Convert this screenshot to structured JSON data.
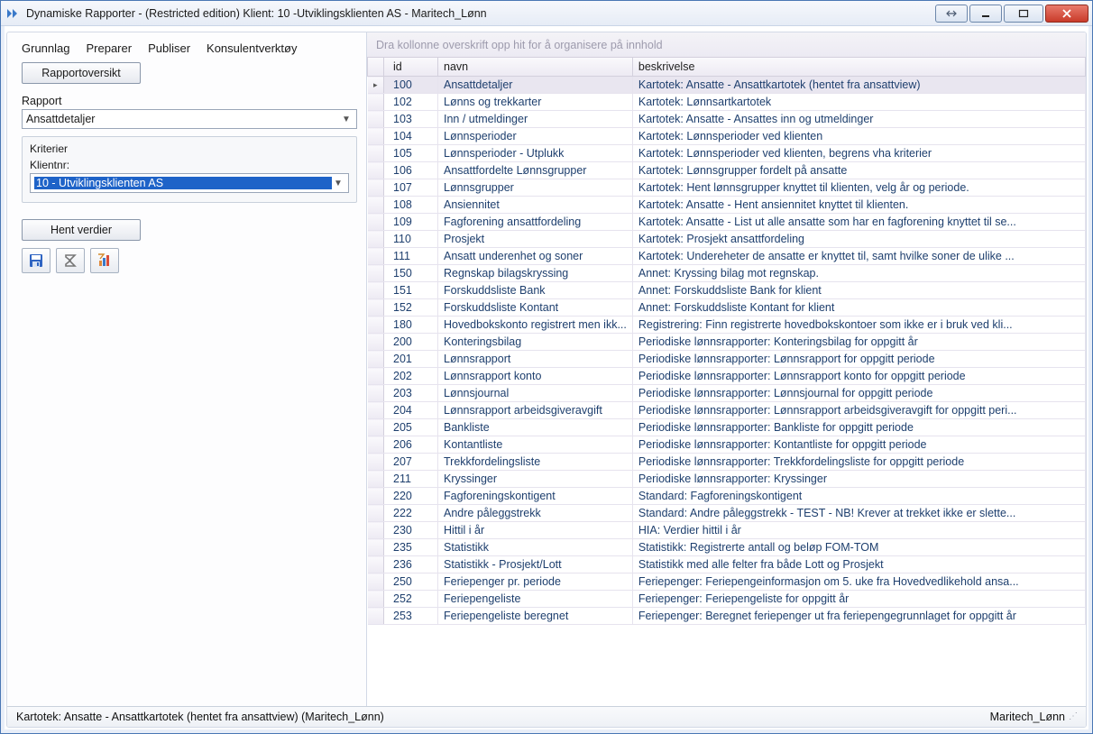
{
  "window": {
    "title": "Dynamiske Rapporter - (Restricted edition)  Klient: 10 -Utviklingsklienten AS - Maritech_Lønn"
  },
  "menubar": {
    "m1": "Grunnlag",
    "m2": "Preparer",
    "m3": "Publiser",
    "m4": "Konsulentverktøy"
  },
  "buttons": {
    "rapportoversikt": "Rapportoversikt",
    "hent_verdier": "Hent verdier"
  },
  "labels": {
    "rapport": "Rapport",
    "kriterier": "Kriterier",
    "klientnr": "Klientnr:"
  },
  "combos": {
    "rapport_value": "Ansattdetaljer",
    "klient_value": "10 - Utviklingsklienten AS"
  },
  "group_strip": "Dra kollonne overskrift opp hit for å organisere på innhold",
  "grid": {
    "headers": {
      "id": "id",
      "navn": "navn",
      "beskrivelse": "beskrivelse"
    },
    "rows": [
      {
        "id": "100",
        "navn": "Ansattdetaljer",
        "beskr": "Kartotek: Ansatte - Ansattkartotek (hentet fra ansattview)",
        "selected": true
      },
      {
        "id": "102",
        "navn": "Lønns og trekkarter",
        "beskr": "Kartotek: Lønnsartkartotek"
      },
      {
        "id": "103",
        "navn": "Inn / utmeldinger",
        "beskr": "Kartotek: Ansatte - Ansattes inn og utmeldinger"
      },
      {
        "id": "104",
        "navn": "Lønnsperioder",
        "beskr": "Kartotek: Lønnsperioder ved klienten"
      },
      {
        "id": "105",
        "navn": "Lønnsperioder - Utplukk",
        "beskr": "Kartotek: Lønnsperioder ved klienten, begrens vha kriterier"
      },
      {
        "id": "106",
        "navn": "Ansattfordelte Lønnsgrupper",
        "beskr": "Kartotek: Lønnsgrupper fordelt på ansatte"
      },
      {
        "id": "107",
        "navn": "Lønnsgrupper",
        "beskr": "Kartotek: Hent lønnsgrupper knyttet til klienten, velg år og periode."
      },
      {
        "id": "108",
        "navn": "Ansiennitet",
        "beskr": "Kartotek: Ansatte - Hent ansiennitet knyttet til klienten."
      },
      {
        "id": "109",
        "navn": "Fagforening ansattfordeling",
        "beskr": "Kartotek: Ansatte - List ut alle ansatte som har en fagforening knyttet til se..."
      },
      {
        "id": "110",
        "navn": "Prosjekt",
        "beskr": "Kartotek: Prosjekt ansattfordeling"
      },
      {
        "id": "111",
        "navn": "Ansatt underenhet og soner",
        "beskr": "Kartotek: Undereheter de ansatte er knyttet til, samt hvilke soner de ulike ..."
      },
      {
        "id": "150",
        "navn": "Regnskap bilagskryssing",
        "beskr": "Annet: Kryssing bilag mot regnskap."
      },
      {
        "id": "151",
        "navn": "Forskuddsliste Bank",
        "beskr": "Annet: Forskuddsliste Bank for klient"
      },
      {
        "id": "152",
        "navn": "Forskuddsliste Kontant",
        "beskr": "Annet: Forskuddsliste Kontant for klient"
      },
      {
        "id": "180",
        "navn": "Hovedbokskonto registrert men ikk...",
        "beskr": "Registrering: Finn registrerte hovedbokskontoer som ikke er i bruk ved kli..."
      },
      {
        "id": "200",
        "navn": "Konteringsbilag",
        "beskr": "Periodiske lønnsrapporter: Konteringsbilag for oppgitt år"
      },
      {
        "id": "201",
        "navn": "Lønnsrapport",
        "beskr": "Periodiske lønnsrapporter: Lønnsrapport for oppgitt periode"
      },
      {
        "id": "202",
        "navn": "Lønnsrapport konto",
        "beskr": "Periodiske lønnsrapporter: Lønnsrapport konto for oppgitt periode"
      },
      {
        "id": "203",
        "navn": "Lønnsjournal",
        "beskr": "Periodiske lønnsrapporter: Lønnsjournal for oppgitt periode"
      },
      {
        "id": "204",
        "navn": "Lønnsrapport arbeidsgiveravgift",
        "beskr": "Periodiske lønnsrapporter: Lønnsrapport arbeidsgiveravgift for oppgitt peri..."
      },
      {
        "id": "205",
        "navn": "Bankliste",
        "beskr": "Periodiske lønnsrapporter: Bankliste  for oppgitt periode"
      },
      {
        "id": "206",
        "navn": "Kontantliste",
        "beskr": "Periodiske lønnsrapporter: Kontantliste for oppgitt periode"
      },
      {
        "id": "207",
        "navn": "Trekkfordelingsliste",
        "beskr": "Periodiske lønnsrapporter: Trekkfordelingsliste for oppgitt periode"
      },
      {
        "id": "211",
        "navn": "Kryssinger",
        "beskr": "Periodiske lønnsrapporter: Kryssinger"
      },
      {
        "id": "220",
        "navn": "Fagforeningskontigent",
        "beskr": "Standard: Fagforeningskontigent"
      },
      {
        "id": "222",
        "navn": "Andre påleggstrekk",
        "beskr": "Standard: Andre påleggstrekk - TEST - NB! Krever at trekket ikke er slette..."
      },
      {
        "id": "230",
        "navn": "Hittil i år",
        "beskr": "HIA: Verdier hittil i år"
      },
      {
        "id": "235",
        "navn": "Statistikk",
        "beskr": "Statistikk: Registrerte antall og beløp FOM-TOM"
      },
      {
        "id": "236",
        "navn": "Statistikk - Prosjekt/Lott",
        "beskr": "Statistikk med alle felter fra både Lott og Prosjekt"
      },
      {
        "id": "250",
        "navn": "Feriepenger pr. periode",
        "beskr": "Feriepenger: Feriepengeinformasjon om 5. uke fra Hovedvedlikehold ansa..."
      },
      {
        "id": "252",
        "navn": "Feriepengeliste",
        "beskr": "Feriepenger: Feriepengeliste for oppgitt år"
      },
      {
        "id": "253",
        "navn": "Feriepengeliste beregnet",
        "beskr": "Feriepenger: Beregnet feriepenger ut fra feriepengegrunnlaget for oppgitt år"
      }
    ]
  },
  "statusbar": {
    "left": "Kartotek: Ansatte - Ansattkartotek (hentet fra ansattview) (Maritech_Lønn)",
    "right": "Maritech_Lønn"
  }
}
